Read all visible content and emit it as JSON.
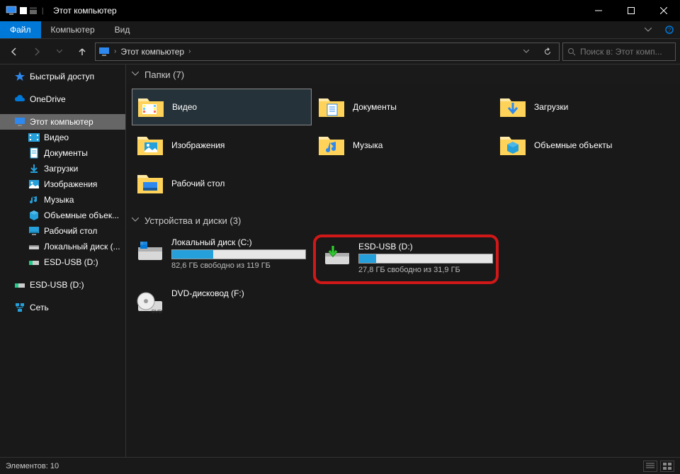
{
  "window": {
    "title": "Этот компьютер"
  },
  "ribbon": {
    "file": "Файл",
    "computer": "Компьютер",
    "view": "Вид"
  },
  "nav": {
    "crumb1": "Этот компьютер"
  },
  "search": {
    "placeholder": "Поиск в: Этот комп..."
  },
  "sidebar": {
    "quick": "Быстрый доступ",
    "onedrive": "OneDrive",
    "thispc": "Этот компьютер",
    "video": "Видео",
    "docs": "Документы",
    "downloads": "Загрузки",
    "pictures": "Изображения",
    "music": "Музыка",
    "objects3d": "Объемные объек...",
    "desktop": "Рабочий стол",
    "localdisk": "Локальный диск (...",
    "esdusb1": "ESD-USB (D:)",
    "esdusb2": "ESD-USB (D:)",
    "network": "Сеть"
  },
  "groups": {
    "folders": {
      "label": "Папки (7)"
    },
    "drives": {
      "label": "Устройства и диски (3)"
    }
  },
  "folders": {
    "video": "Видео",
    "docs": "Документы",
    "downloads": "Загрузки",
    "pictures": "Изображения",
    "music": "Музыка",
    "objects3d": "Объемные объекты",
    "desktop": "Рабочий стол"
  },
  "drives": {
    "c": {
      "name": "Локальный диск (C:)",
      "sub": "82,6 ГБ свободно из 119 ГБ",
      "fill": 31
    },
    "d": {
      "name": "ESD-USB (D:)",
      "sub": "27,8 ГБ свободно из 31,9 ГБ",
      "fill": 13
    },
    "f": {
      "name": "DVD-дисковод (F:)"
    }
  },
  "status": {
    "count": "Элементов: 10"
  }
}
